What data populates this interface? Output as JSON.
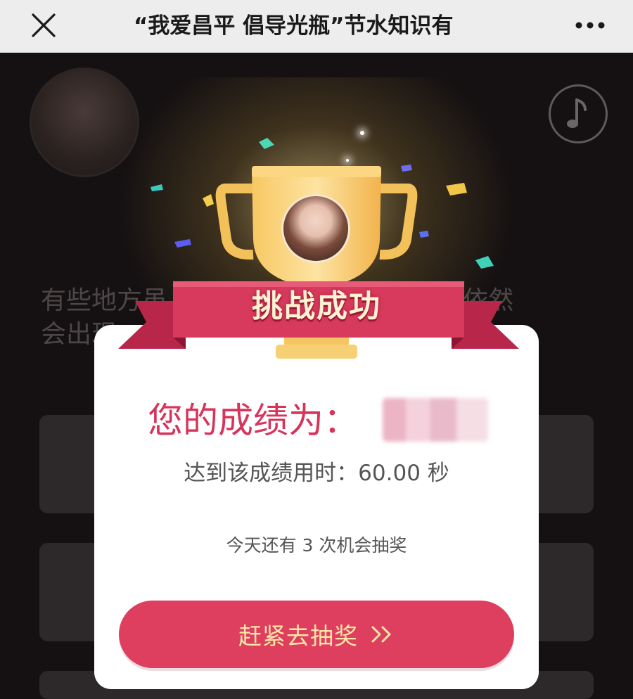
{
  "colors": {
    "accent": "#de3f5e",
    "score_text": "#d8335a",
    "button_text": "#fde7a8",
    "trophy_gold": "#f5c15c",
    "ribbon": "#d83a5d",
    "background": "#151112"
  },
  "navbar": {
    "title": "“我爱昌平 倡导光瓶”节水知识有",
    "close_icon": "close-icon",
    "more_icon": "more-icon"
  },
  "background_page": {
    "question_text": "有些地方虽                                ），依然\n会出现",
    "music_icon": "music-note-icon"
  },
  "popup": {
    "banner": "挑战成功",
    "score_label": "您的成绩为：",
    "time_label": "达到该成绩用时：60.00 秒",
    "chances_label": "今天还有 3 次机会抽奖",
    "button_label": "赶紧去抽奖",
    "button_icon": "double-chevron-right-icon"
  }
}
